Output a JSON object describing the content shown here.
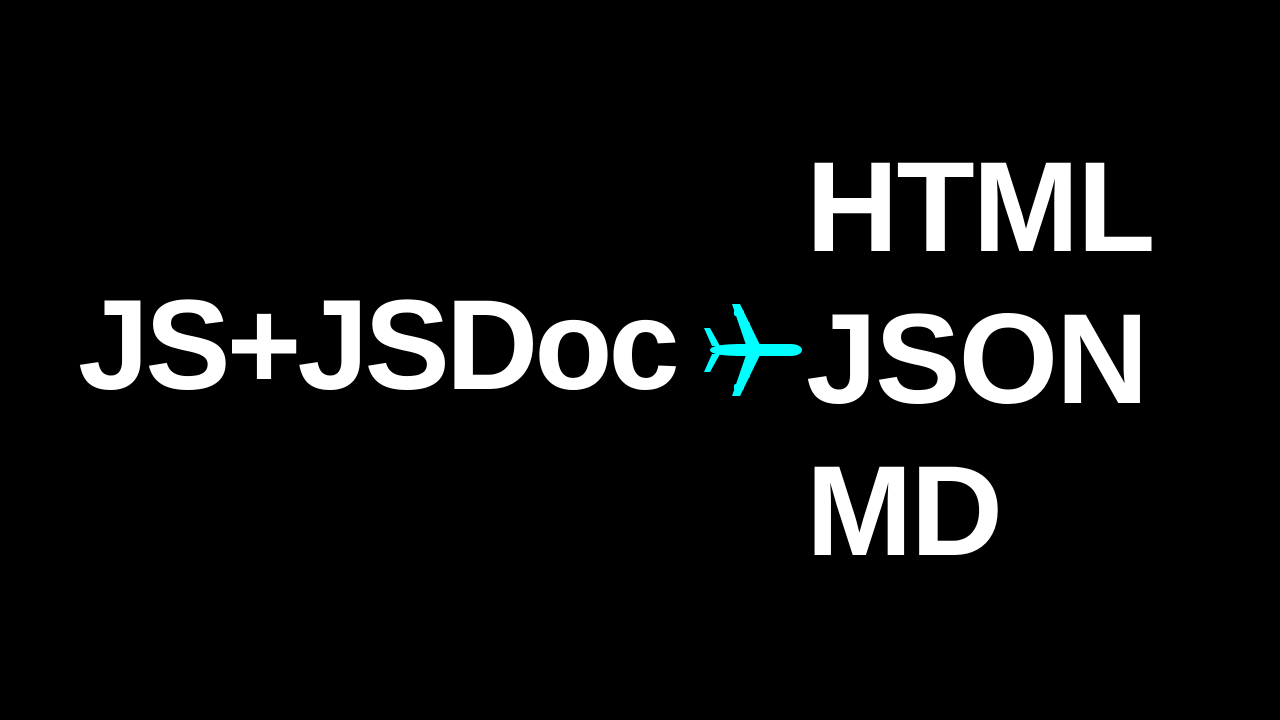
{
  "source": {
    "label": "JS+JSDoc"
  },
  "arrow": {
    "icon": "airplane-icon",
    "color": "#00ffff"
  },
  "targets": [
    {
      "label": "HTML"
    },
    {
      "label": "JSON"
    },
    {
      "label": "MD"
    }
  ]
}
